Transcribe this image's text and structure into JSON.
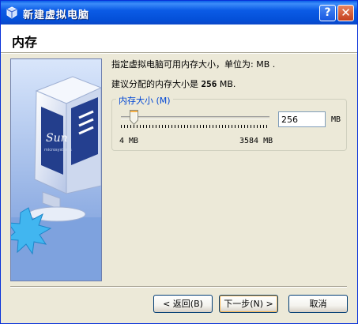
{
  "window": {
    "title": "新建虚拟电脑"
  },
  "titlebar": {
    "help_symbol": "?",
    "close_symbol": "✕",
    "icon": "virtualbox-icon"
  },
  "header": {
    "title": "内存"
  },
  "content": {
    "line1": "指定虚拟电脑可用内存大小，单位为: MB .",
    "line2_prefix": "建议分配的内存大小是 ",
    "line2_value": "256",
    "line2_suffix": " MB."
  },
  "memory_group": {
    "label": "内存大小 (M)",
    "value": "256",
    "unit": "MB",
    "min_label": "4 MB",
    "max_label": "3584 MB",
    "slider_min": 4,
    "slider_max": 3584,
    "slider_value": 256
  },
  "side_image": {
    "logo_text": "Sun",
    "logo_sub": "microsystems"
  },
  "buttons": {
    "back": "< 返回(B)",
    "next": "下一步(N) >",
    "cancel": "取消"
  },
  "colors": {
    "titlebar": "#0a5fe8",
    "accent": "#0046d5",
    "dialog_bg": "#ece9d8"
  }
}
